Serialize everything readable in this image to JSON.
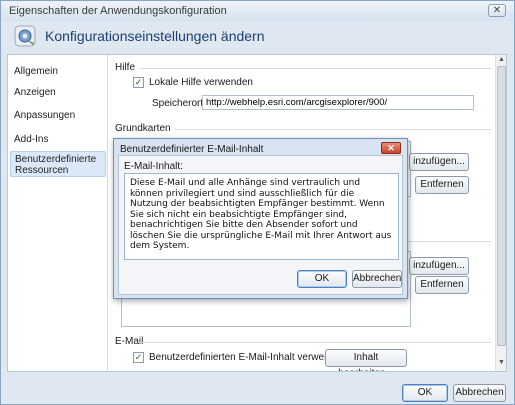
{
  "window": {
    "title": "Eigenschaften der Anwendungskonfiguration",
    "close_symbol": "✕",
    "heading": "Konfigurationseinstellungen ändern",
    "app_icon": "config-gear-icon"
  },
  "nav": {
    "items": [
      {
        "label": "Allgemein"
      },
      {
        "label": "Anzeigen"
      },
      {
        "label": "Anpassungen"
      },
      {
        "label": "Add-Ins"
      },
      {
        "label": "Benutzerdefinierte Ressourcen",
        "selected": true
      }
    ]
  },
  "hilfe": {
    "section_label": "Hilfe",
    "checkbox_label": "Lokale Hilfe verwenden",
    "checked": true,
    "speicherort_label": "Speicherort:",
    "speicherort_value": "http://webhelp.esri.com/arcgisexplorer/900/"
  },
  "grundkarten": {
    "section_label": "Grundkarten",
    "add_label": "inzufügen...",
    "remove_label": "Entfernen"
  },
  "second_group": {
    "add_label": "inzufügen...",
    "remove_label": "Entfernen"
  },
  "email": {
    "section_label": "E-Mail",
    "checkbox_label": "Benutzerdefinierten E-Mail-Inhalt verwenden",
    "checked": true,
    "edit_button": "Inhalt bearbeiten..."
  },
  "footer": {
    "ok": "OK",
    "cancel": "Abbrechen"
  },
  "child_dialog": {
    "title": "Benutzerdefinierter E-Mail-Inhalt",
    "close_symbol": "✕",
    "label": "E-Mail-Inhalt:",
    "content": "Diese E-Mail und alle Anhänge sind vertraulich und können privilegiert und sind ausschließlich für die Nutzung der beabsichtigten Empfänger bestimmt. Wenn Sie sich nicht ein beabsichtigte Empfänger sind, benachrichtigen Sie bitte den Absender sofort und löschen Sie die ursprüngliche E-Mail mit Ihrer Antwort aus dem System.",
    "ok": "OK",
    "cancel": "Abbrechen"
  },
  "colors": {
    "accent": "#1e3f70",
    "selection": "#dbe8f7"
  }
}
